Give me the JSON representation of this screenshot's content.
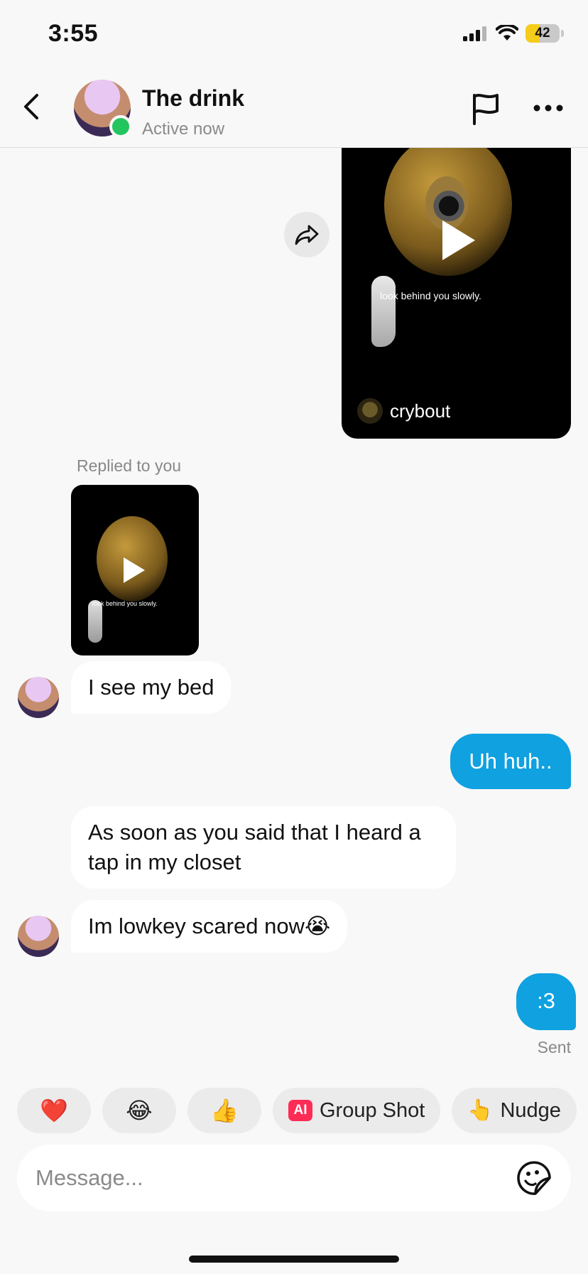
{
  "status_bar": {
    "time": "3:55",
    "battery": "42"
  },
  "header": {
    "name": "The drink",
    "status": "Active now"
  },
  "shared_video": {
    "caption": "look behind you slowly.",
    "username": "crybout"
  },
  "reply": {
    "label": "Replied to you",
    "thumb_caption": "look behind you slowly."
  },
  "messages": [
    {
      "text": "I see my bed",
      "direction": "in"
    },
    {
      "text": "Uh huh..",
      "direction": "out"
    },
    {
      "text": "As soon as you said that I heard a tap in my closet",
      "direction": "in"
    },
    {
      "text": "Im lowkey scared now😭",
      "direction": "in"
    },
    {
      "text": ":3",
      "direction": "out"
    }
  ],
  "sent_label": "Sent",
  "quick_replies": {
    "heart": "❤️",
    "laugh": "😂",
    "thumbs_up": "👍",
    "ai_badge": "AI",
    "group_shot": "Group Shot",
    "nudge_emoji": "👆",
    "nudge": "Nudge"
  },
  "composer": {
    "placeholder": "Message..."
  },
  "colors": {
    "accent": "#0fa1e0",
    "online": "#22c55e",
    "ai_badge": "#fe2c55"
  }
}
